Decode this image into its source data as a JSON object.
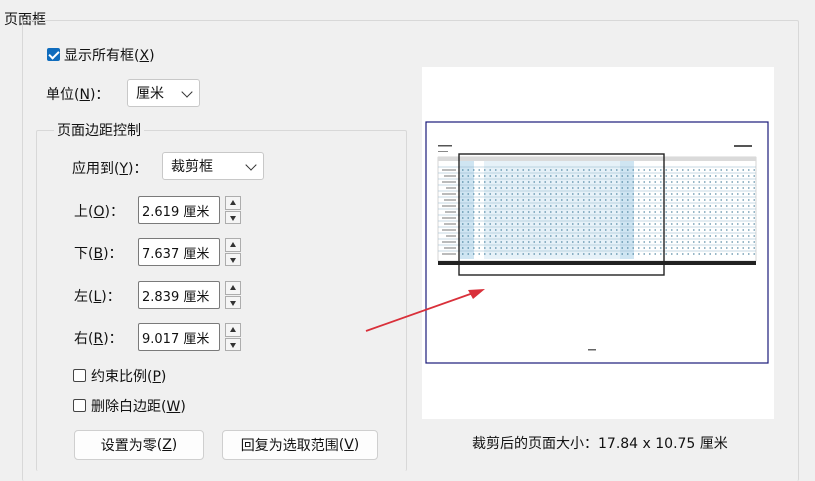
{
  "group": {
    "title": "页面框"
  },
  "show_all": {
    "label": "显示所有框",
    "key": "X",
    "checked": true
  },
  "unit": {
    "label": "单位",
    "key": "N",
    "value": "厘米"
  },
  "margin": {
    "title": "页面边距控制",
    "apply_to": {
      "label": "应用到",
      "key": "Y",
      "value": "裁剪框"
    },
    "top": {
      "label": "上",
      "key": "O",
      "value": "2.619 厘米"
    },
    "bottom": {
      "label": "下",
      "key": "B",
      "value": "7.637 厘米"
    },
    "left": {
      "label": "左",
      "key": "L",
      "value": "2.839 厘米"
    },
    "right": {
      "label": "右",
      "key": "R",
      "value": "9.017 厘米"
    },
    "constrain": {
      "label": "约束比例",
      "key": "P",
      "checked": false
    },
    "remove_white": {
      "label": "删除白边距",
      "key": "W",
      "checked": false
    }
  },
  "buttons": {
    "zero": {
      "label": "设置为零",
      "key": "Z"
    },
    "revert": {
      "label": "回复为选取范围",
      "key": "V"
    }
  },
  "preview": {
    "size_text": "裁剪后的页面大小：17.84 x 10.75 厘米"
  },
  "colors": {
    "accent": "#0f6cbd",
    "arrow": "#d9303a",
    "page_border": "#1a1a7a"
  }
}
